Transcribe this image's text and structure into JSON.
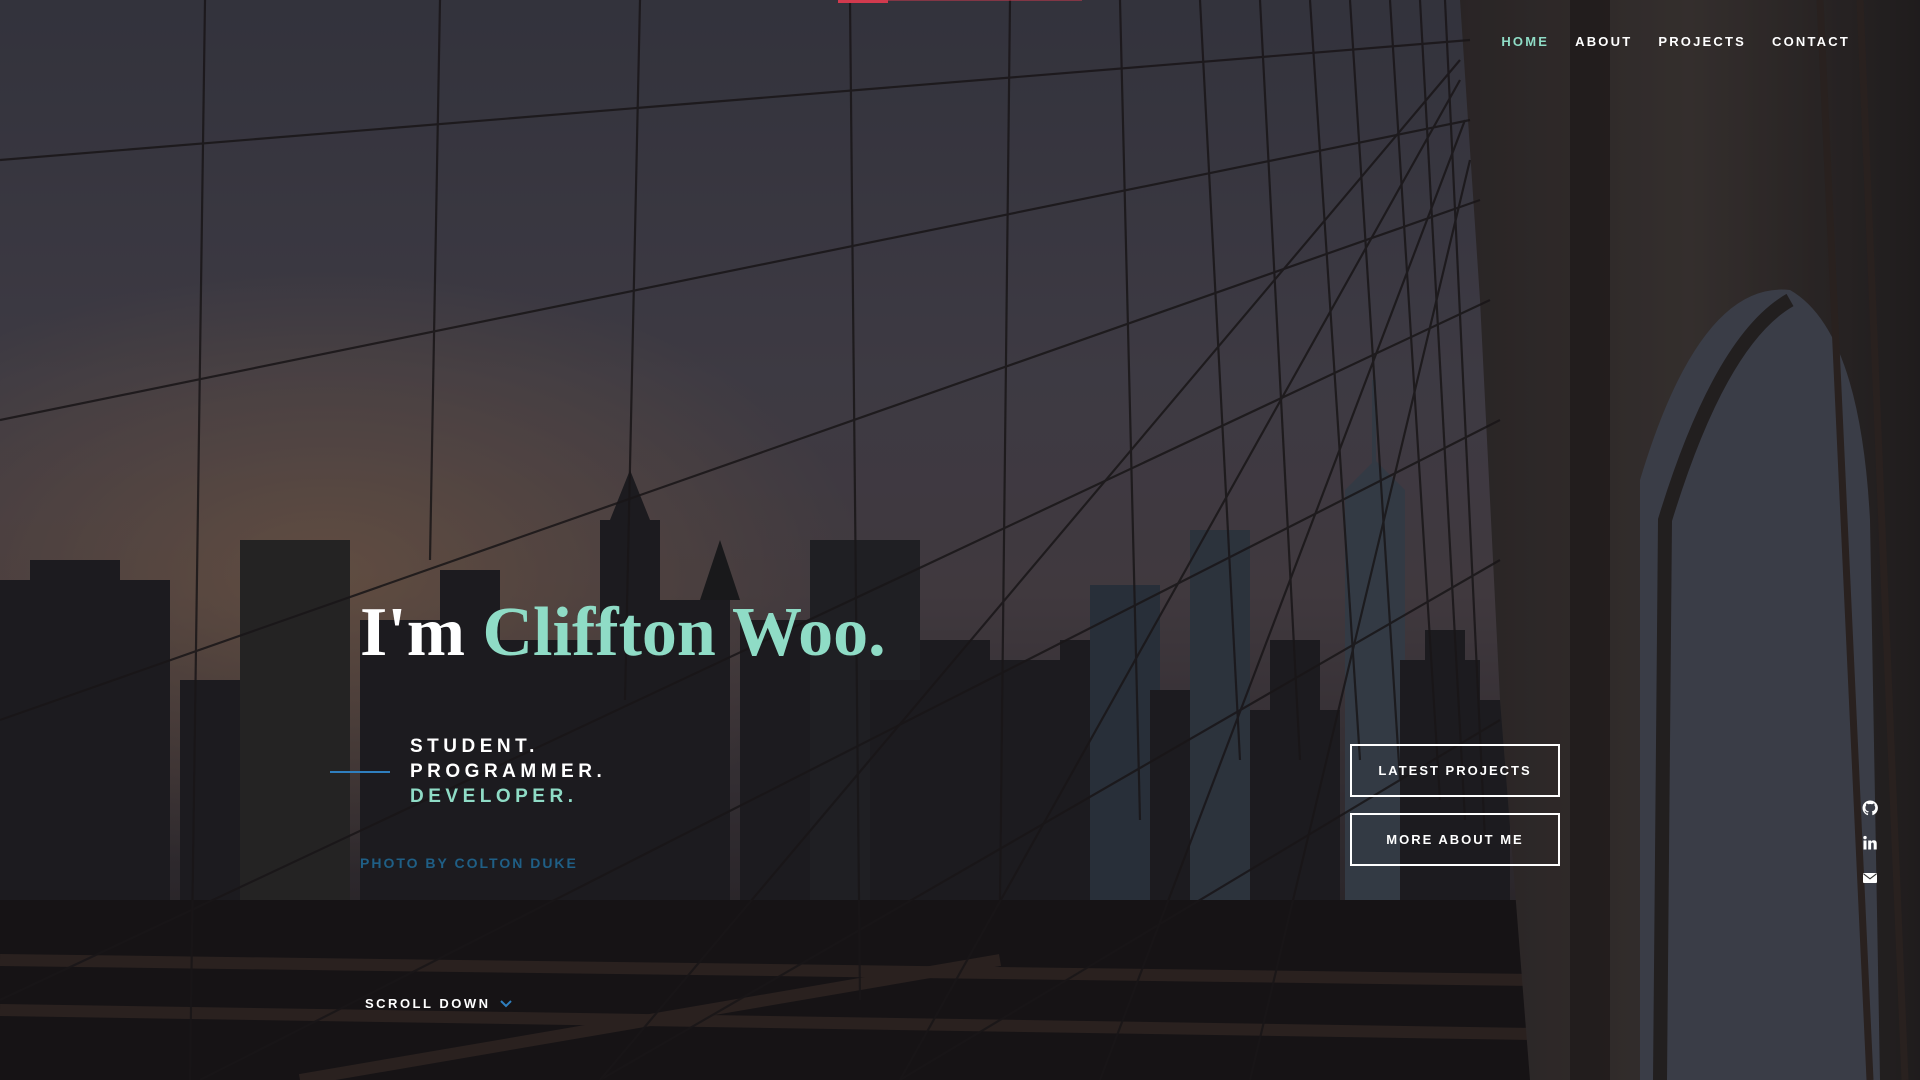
{
  "nav": {
    "items": [
      {
        "label": "HOME",
        "active": true
      },
      {
        "label": "ABOUT",
        "active": false
      },
      {
        "label": "PROJECTS",
        "active": false
      },
      {
        "label": "CONTACT",
        "active": false
      }
    ]
  },
  "hero": {
    "intro_prefix": "I'm ",
    "intro_name": "Cliffton Woo.",
    "tagline": [
      "STUDENT.",
      "PROGRAMMER.",
      "DEVELOPER."
    ],
    "photo_credit": "PHOTO BY COLTON DUKE"
  },
  "buttons": {
    "latest_projects": "LATEST PROJECTS",
    "more_about": "MORE ABOUT ME"
  },
  "social": {
    "icons": [
      "github-icon",
      "linkedin-icon",
      "mail-icon"
    ]
  },
  "scroll": {
    "label": "SCROLL DOWN",
    "icon": "chevron-down-icon"
  },
  "colors": {
    "accent": "#8fdcc6",
    "rule_blue": "#2f7fbf",
    "credit_blue": "#1f5f86",
    "top_accent": "#d23a4e"
  }
}
